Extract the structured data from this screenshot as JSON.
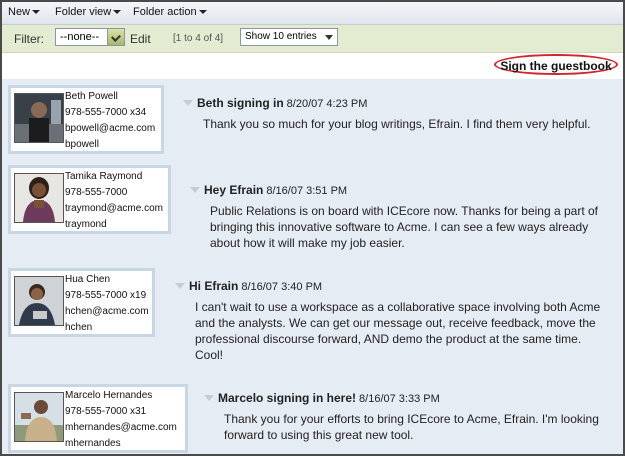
{
  "menus": {
    "new": "New",
    "folder_view": "Folder view",
    "folder_action": "Folder action"
  },
  "filter": {
    "label": "Filter:",
    "selected": "--none--",
    "edit": "Edit",
    "range": "[1 to 4 of 4]",
    "show_entries": "Show 10 entries"
  },
  "guestbook": {
    "sign_label": "Sign the guestbook"
  },
  "colors": {
    "accent_red": "#d0262a",
    "filter_bg": "#e3ecd0",
    "entry_bg": "#e6ecf4"
  },
  "entries": [
    {
      "name": "Beth Powell",
      "phone": "978-555-7000 x34",
      "email": "bpowell@acme.com",
      "user": "bpowell",
      "title": "Beth signing in",
      "date": "8/20/07 4:23 PM",
      "body": [
        "Thank you so much for your blog writings, Efrain. I find them very helpful."
      ]
    },
    {
      "name": "Tamika Raymond",
      "phone": "978-555-7000",
      "email": "traymond@acme.com",
      "user": "traymond",
      "title": "Hey Efrain",
      "date": "8/16/07 3:51 PM",
      "body": [
        "Public Relations is on board with ICEcore now. Thanks for being a part of",
        "bringing this innovative software to Acme. I can see a few ways already",
        "about how it will make my job easier."
      ]
    },
    {
      "name": "Hua Chen",
      "phone": "978-555-7000 x19",
      "email": "hchen@acme.com",
      "user": "hchen",
      "title": "Hi Efrain",
      "date": "8/16/07 3:40 PM",
      "body": [
        "I can't wait to use a workspace as a collaborative space involving both Acme",
        "and the analysts. We can get our message out, receive feedback, move the",
        "professional discourse forward, AND demo the product at the same time.",
        "Cool!"
      ]
    },
    {
      "name": "Marcelo Hernandes",
      "phone": "978-555-7000 x31",
      "email": "mhernandes@acme.com",
      "user": "mhernandes",
      "title": "Marcelo signing in here!",
      "date": "8/16/07 3:33 PM",
      "body": [
        "Thank you for your efforts to bring ICEcore to Acme, Efrain. I'm looking",
        "forward to using this great new tool."
      ]
    }
  ]
}
